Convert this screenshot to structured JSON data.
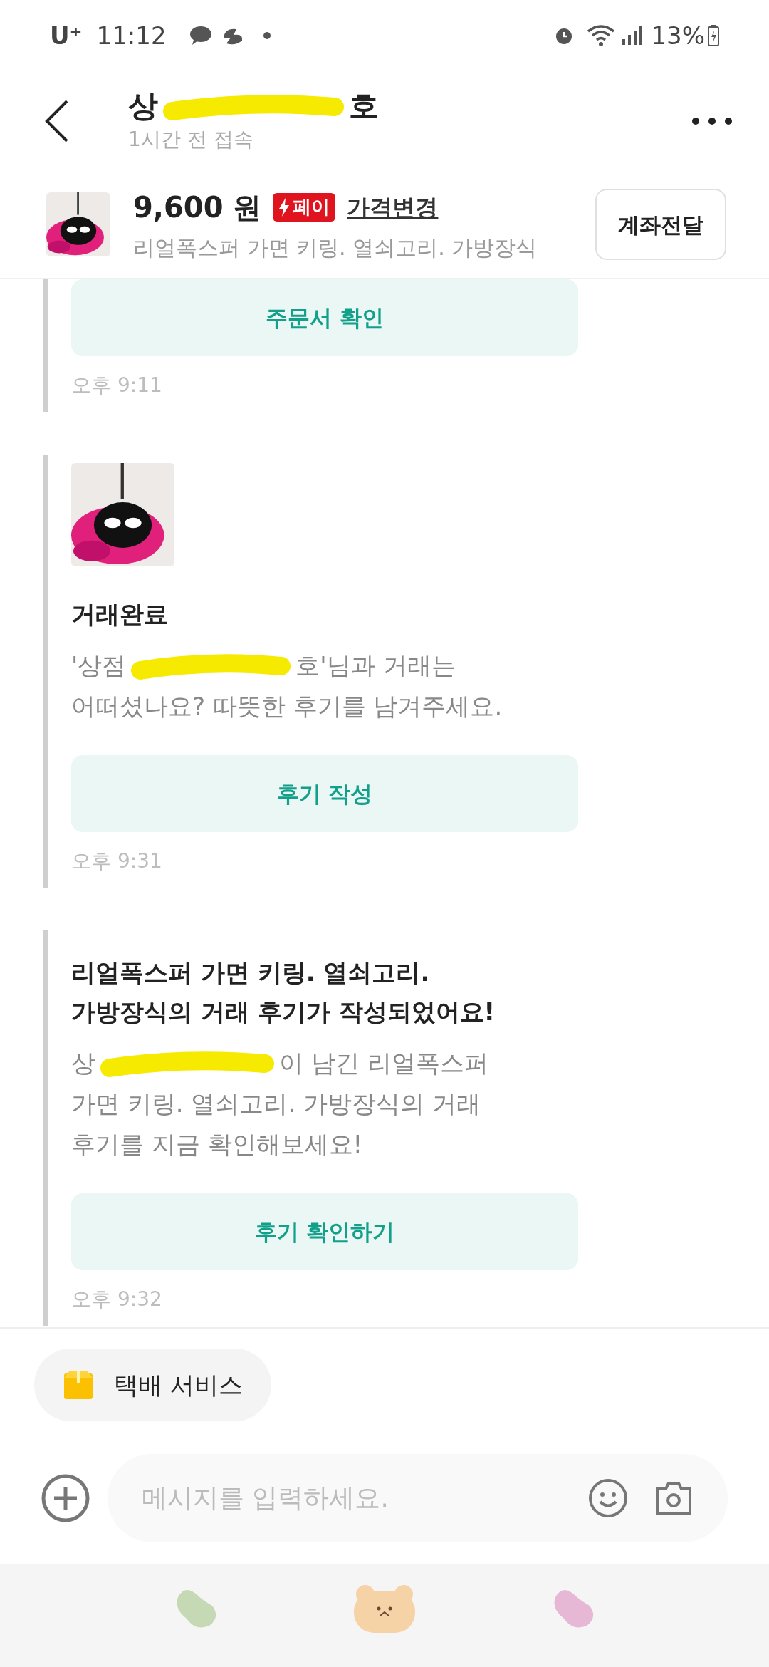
{
  "status_bar": {
    "carrier": "U⁺",
    "time": "11:12",
    "battery": "13%"
  },
  "header": {
    "title_before": "상",
    "title_after": "호",
    "subtitle": "1시간 전 접속"
  },
  "product": {
    "price": "9,600 원",
    "pay_badge": "페이",
    "price_change": "가격변경",
    "name": "리얼폭스퍼 가면 키링. 열쇠고리. 가방장식",
    "account_button": "계좌전달"
  },
  "messages": [
    {
      "kind": "cut",
      "button": "주문서 확인",
      "time": "오후 9:11"
    },
    {
      "kind": "done",
      "title": "거래완료",
      "body_before": "'상점",
      "body_after": "호'님과 거래는\n어떠셨나요? 따뜻한 후기를 남겨주세요.",
      "button": "후기 작성",
      "time": "오후 9:31"
    },
    {
      "kind": "review",
      "title": "리얼폭스퍼 가면 키링. 열쇠고리.\n가방장식의 거래 후기가 작성되었어요!",
      "body_before": "상",
      "body_after": "이 남긴 리얼폭스퍼\n가면 키링. 열쇠고리. 가방장식의 거래\n후기를 지금 확인해보세요!",
      "button": "후기 확인하기",
      "time": "오후 9:32"
    }
  ],
  "delivery_chip": "택배 서비스",
  "input": {
    "placeholder": "메시지를 입력하세요."
  }
}
